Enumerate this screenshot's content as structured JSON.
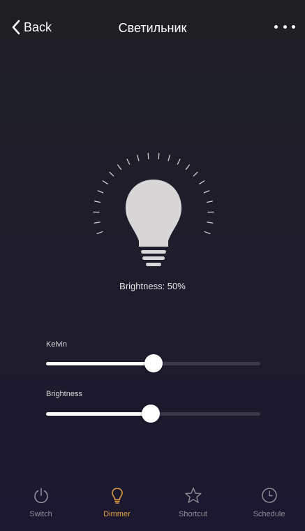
{
  "nav": {
    "back_label": "Back",
    "title": "Светильник"
  },
  "bulb": {
    "label": "Brightness: 50%"
  },
  "sliders": [
    {
      "label": "Kelvin",
      "value": 0.5
    },
    {
      "label": "Brightness",
      "value": 0.49
    }
  ],
  "tabs": [
    {
      "label": "Switch",
      "icon": "power-icon",
      "active": false
    },
    {
      "label": "Dimmer",
      "icon": "lightbulb-icon",
      "active": true
    },
    {
      "label": "Shortcut",
      "icon": "star-icon",
      "active": false
    },
    {
      "label": "Schedule",
      "icon": "clock-icon",
      "active": false
    }
  ],
  "colors": {
    "accent": "#e5a340",
    "inactive": "#8e8e97",
    "bulb": "#d9d6d8",
    "track": "#3c3a48"
  }
}
